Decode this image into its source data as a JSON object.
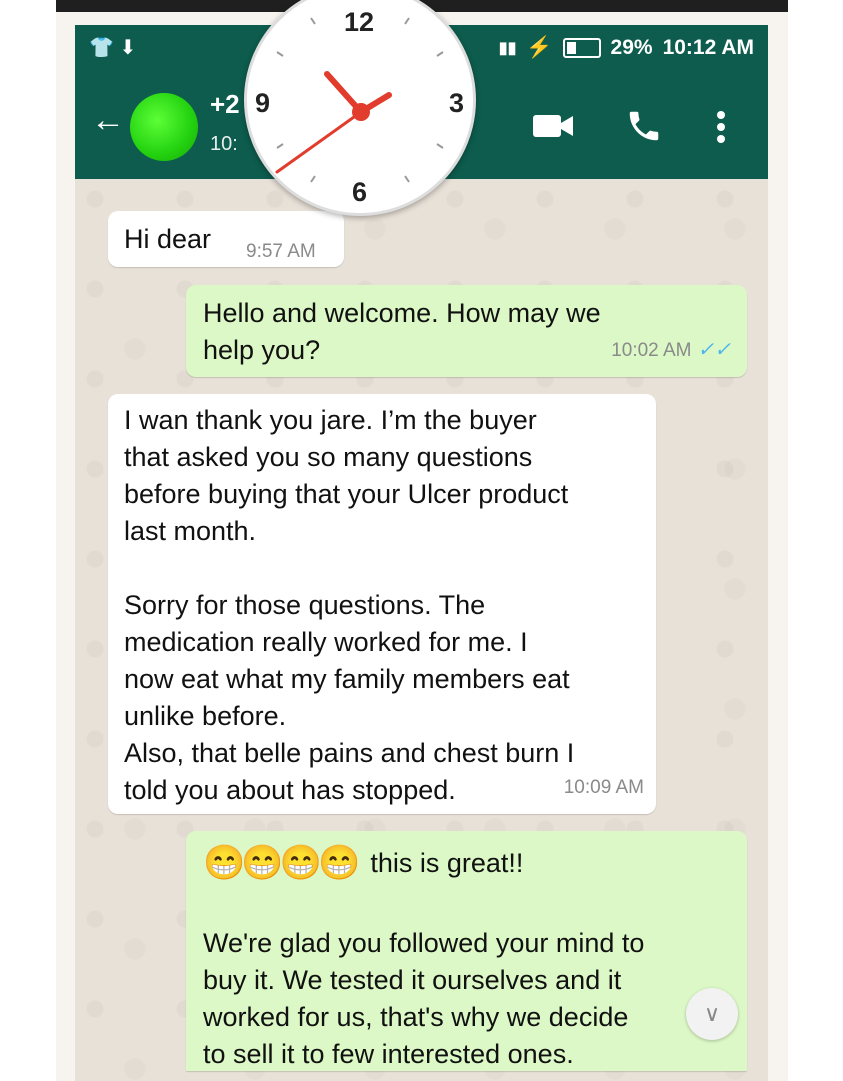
{
  "status_bar": {
    "battery": "29%",
    "time": "10:12 AM"
  },
  "header": {
    "contact_name_partial": "+2",
    "last_seen_partial": "10:"
  },
  "clock_overlay": {
    "numbers": [
      "12",
      "3",
      "6",
      "9"
    ]
  },
  "messages": [
    {
      "direction": "in",
      "text": "Hi dear",
      "time": "9:57 AM"
    },
    {
      "direction": "out",
      "lines": [
        "Hello and welcome. How may we",
        "help you?"
      ],
      "time": "10:02 AM"
    },
    {
      "direction": "in",
      "lines": [
        "I wan thank you jare. I’m the buyer",
        "that asked you so many questions",
        "before buying that your Ulcer product",
        "last month.",
        "",
        "Sorry for those questions. The",
        "medication really worked for me. I",
        "now eat what my family members eat",
        "unlike before.",
        "Also, that belle pains and chest burn I",
        "told you about has stopped."
      ],
      "time": "10:09 AM"
    },
    {
      "direction": "out",
      "first_line": "this is great!!",
      "lines": [
        "We're glad you followed your mind to",
        "buy it. We tested it ourselves and it",
        "worked for us, that's why we decide",
        "to sell it to few interested ones."
      ]
    }
  ],
  "icons": [
    "back-arrow-icon",
    "video-call-icon",
    "voice-call-icon",
    "more-options-icon",
    "scroll-down-icon"
  ]
}
